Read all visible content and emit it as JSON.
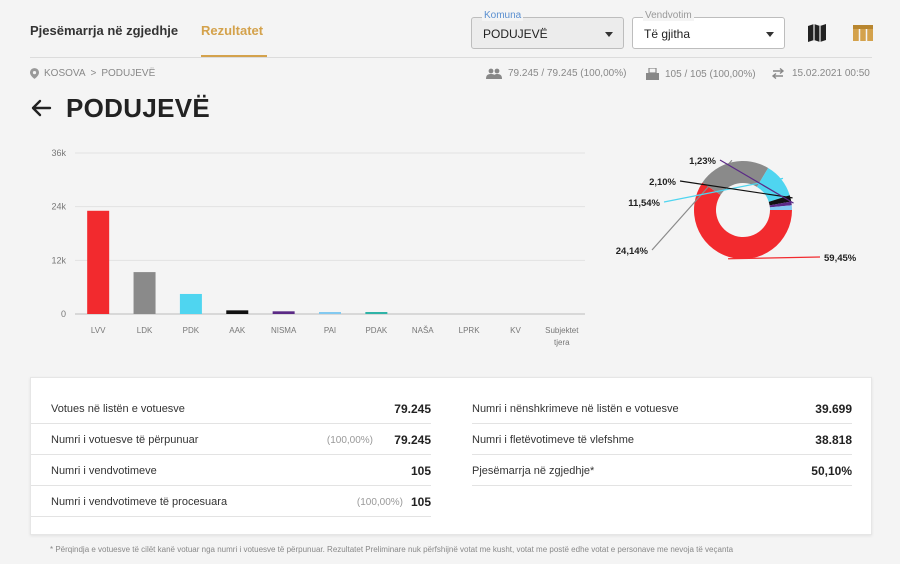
{
  "header": {
    "tab_participation": "Pjesëmarrja në zgjedhje",
    "tab_results": "Rezultatet",
    "komuna": {
      "label": "Komuna",
      "value": "PODUJEVË"
    },
    "vendvotim": {
      "label": "Vendvotim",
      "value": "Të gjitha"
    }
  },
  "breadcrumb": {
    "root": "KOSOVA",
    "separator": ">",
    "current": "PODUJEVË"
  },
  "meta": {
    "voters": "79.245 / 79.245 (100,00%)",
    "stations": "105 / 105 (100,00%)",
    "updated": "15.02.2021 00:50"
  },
  "page_title": "PODUJEVË",
  "icons": {
    "location": "location-pin-icon",
    "people": "people-icon",
    "ballot": "ballot-box-icon",
    "sync": "sync-icon",
    "map": "map-icon",
    "table": "table-icon",
    "back": "back-arrow-icon"
  },
  "colors": {
    "accent": "#d4a24c",
    "LVV": "#f22a2e",
    "LDK": "#8a8a8a",
    "PDK": "#4fd5f0",
    "AAK": "#111111",
    "NISMA": "#5b2a86",
    "PAI": "#82c9f0",
    "PDAK": "#2fb3a7"
  },
  "chart_data": [
    {
      "type": "bar",
      "categories": [
        "LVV",
        "LDK",
        "PDK",
        "AAK",
        "NISMA",
        "PAI",
        "PDAK",
        "NAŠA",
        "LPRK",
        "KV",
        "Subjektet tjera"
      ],
      "values": [
        23080,
        9370,
        4480,
        815,
        600,
        60,
        150,
        0,
        0,
        0,
        0
      ],
      "colors": [
        "#f22a2e",
        "#8a8a8a",
        "#4fd5f0",
        "#111111",
        "#5b2a86",
        "#82c9f0",
        "#2fb3a7",
        "#cccccc",
        "#cccccc",
        "#cccccc",
        "#cccccc"
      ],
      "yticks": [
        "0",
        "12k",
        "24k",
        "36k"
      ],
      "ylim": [
        0,
        36000
      ],
      "grid": true
    },
    {
      "type": "pie",
      "variant": "donut",
      "slices": [
        {
          "party": "LVV",
          "value": 59.45,
          "label": "59,45%",
          "color": "#f22a2e"
        },
        {
          "party": "LDK",
          "value": 24.14,
          "label": "24,14%",
          "color": "#8a8a8a"
        },
        {
          "party": "PDK",
          "value": 11.54,
          "label": "11,54%",
          "color": "#4fd5f0"
        },
        {
          "party": "AAK",
          "value": 2.1,
          "label": "2,10%",
          "color": "#111111"
        },
        {
          "party": "NISMA",
          "value": 1.23,
          "label": "1,23%",
          "color": "#5b2a86"
        },
        {
          "party": "other",
          "value": 1.54,
          "label": "",
          "color": "#82c9f0"
        }
      ]
    }
  ],
  "stats": {
    "left": [
      {
        "label": "Votues në listën e votuesve",
        "pct": "",
        "value": "79.245"
      },
      {
        "label": "Numri i votuesve të përpunuar",
        "pct": "(100,00%)",
        "value": "79.245"
      },
      {
        "label": "Numri i vendvotimeve",
        "pct": "",
        "value": "105"
      },
      {
        "label": "Numri i vendvotimeve të procesuara",
        "pct": "(100,00%)",
        "value": "105"
      }
    ],
    "right": [
      {
        "label": "Numri i nënshkrimeve në listën e votuesve",
        "value": "39.699"
      },
      {
        "label": "Numri i fletëvotimeve të vlefshme",
        "value": "38.818"
      },
      {
        "label": "Pjesëmarrja në zgjedhje*",
        "value": "50,10%"
      }
    ]
  },
  "footnote": "* Përqindja e votuesve të cilët kanë votuar nga numri i votuesve të përpunuar. Rezultatet Preliminare nuk përfshijnë votat me kusht, votat me postë edhe votat e personave me nevoja të veçanta"
}
